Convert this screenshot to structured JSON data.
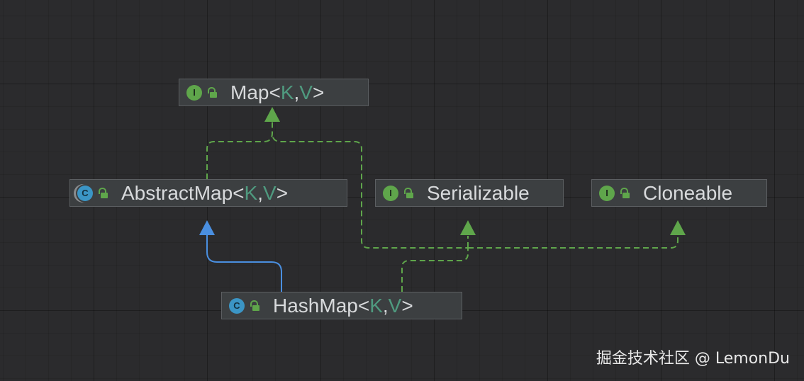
{
  "diagram": {
    "nodes": {
      "map": {
        "kind": "interface",
        "kind_letter": "I",
        "name": "Map",
        "open": "<",
        "k": "K",
        "sep": ", ",
        "v": "V",
        "close": ">"
      },
      "abstract_map": {
        "kind": "abstract class",
        "kind_letter": "C",
        "name": "AbstractMap",
        "open": "<",
        "k": "K",
        "sep": ", ",
        "v": "V",
        "close": ">"
      },
      "serializable": {
        "kind": "interface",
        "kind_letter": "I",
        "name": "Serializable"
      },
      "cloneable": {
        "kind": "interface",
        "kind_letter": "I",
        "name": "Cloneable"
      },
      "hash_map": {
        "kind": "class",
        "kind_letter": "C",
        "name": "HashMap",
        "open": "<",
        "k": "K",
        "sep": ", ",
        "v": "V",
        "close": ">"
      }
    },
    "edges": [
      {
        "from": "AbstractMap",
        "to": "Map",
        "type": "implements"
      },
      {
        "from": "HashMap",
        "to": "Map",
        "type": "implements"
      },
      {
        "from": "HashMap",
        "to": "Serializable",
        "type": "implements"
      },
      {
        "from": "HashMap",
        "to": "Cloneable",
        "type": "implements"
      },
      {
        "from": "HashMap",
        "to": "AbstractMap",
        "type": "extends"
      }
    ],
    "colors": {
      "background": "#2b2b2d",
      "node_fill": "#3c3f41",
      "node_border": "#5c5f62",
      "implements_edge": "#5fa64b",
      "extends_edge": "#4a8fe0",
      "interface_icon": "#5fa64b",
      "class_icon": "#3b95c5",
      "type_param": "#4f9a7f",
      "text": "#d8dadc"
    }
  },
  "watermark": "掘金技术社区 @ LemonDu"
}
